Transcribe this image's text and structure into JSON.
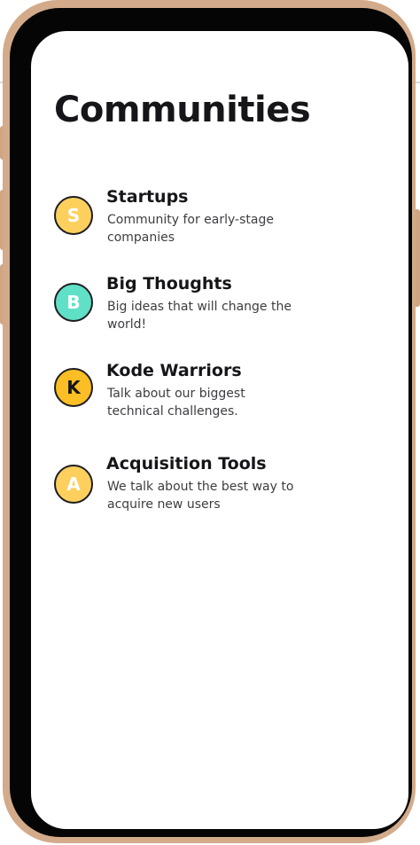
{
  "page": {
    "title": "Communities"
  },
  "communities": [
    {
      "initial": "S",
      "name": "Startups",
      "description": "Community for early-stage companies",
      "avatar_bg": "#fdd05e",
      "avatar_fg": "#ffffff"
    },
    {
      "initial": "B",
      "name": "Big Thoughts",
      "description": "Big ideas that will change the world!",
      "avatar_bg": "#5fe0c7",
      "avatar_fg": "#ffffff"
    },
    {
      "initial": "K",
      "name": "Kode Warriors",
      "description": "Talk about our biggest technical challenges.",
      "avatar_bg": "#fbbe24",
      "avatar_fg": "#16161a"
    },
    {
      "initial": "A",
      "name": "Acquisition Tools",
      "description": "We talk about the best way to acquire new users",
      "avatar_bg": "#fdd05e",
      "avatar_fg": "#ffffff"
    }
  ],
  "colors": {
    "phone_frame": "#d3ab8a",
    "bezel": "#050505",
    "screen_bg": "#ffffff",
    "text_primary": "#16161a",
    "text_secondary": "#3d3d42"
  }
}
